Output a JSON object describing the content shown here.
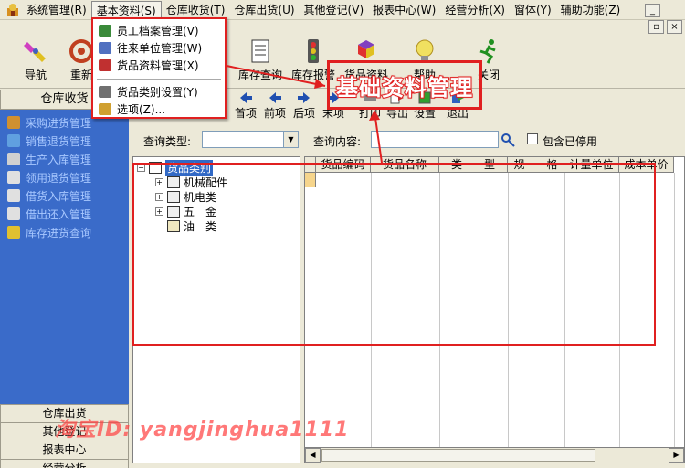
{
  "menubar": {
    "items": [
      "系统管理(R)",
      "基本资料(S)",
      "仓库收货(T)",
      "仓库出货(U)",
      "其他登记(V)",
      "报表中心(W)",
      "经营分析(X)",
      "窗体(Y)",
      "辅助功能(Z)"
    ],
    "mdi_minimize": "_",
    "mdi_restore": "▫",
    "mdi_close": "×"
  },
  "dropdown": {
    "items": [
      "员工档案管理(V)",
      "往来单位管理(W)",
      "货品资料管理(X)",
      "货品类别设置(Y)",
      "选项(Z)..."
    ]
  },
  "toolbar": {
    "buttons": [
      "导航",
      "重新",
      "库存查询",
      "库存报警",
      "货品资料",
      "帮助",
      "关闭"
    ]
  },
  "leftnav": {
    "header": "仓库收货",
    "items": [
      "采购进货管理",
      "销售退货管理",
      "生产入库管理",
      "领用退货管理",
      "借货入库管理",
      "借出还入管理",
      "库存进货查询"
    ],
    "bottom_tabs": [
      "仓库出货",
      "其他登记",
      "报表中心",
      "经营分析"
    ]
  },
  "subbar": {
    "buttons": [
      "首项",
      "前项",
      "后项",
      "末项",
      "打印",
      "导出",
      "设置",
      "退出"
    ]
  },
  "query": {
    "type_label": "查询类型:",
    "type_value": "",
    "content_label": "查询内容:",
    "content_value": "",
    "include_disabled_label": "包含已停用",
    "include_disabled_checked": false
  },
  "tree": {
    "root": "货品类别",
    "children": [
      "机械配件",
      "机电类",
      "五　金",
      "油　类"
    ]
  },
  "grid": {
    "columns": [
      "货品编码",
      "货品名称",
      "类　　型",
      "规　　格",
      "计量单位",
      "成本单价"
    ],
    "rows": []
  },
  "annotations": {
    "callout": "基础资料管理",
    "watermark": "淘宝ID:  yangjinghua1111",
    "accent_color": "#e02020"
  }
}
